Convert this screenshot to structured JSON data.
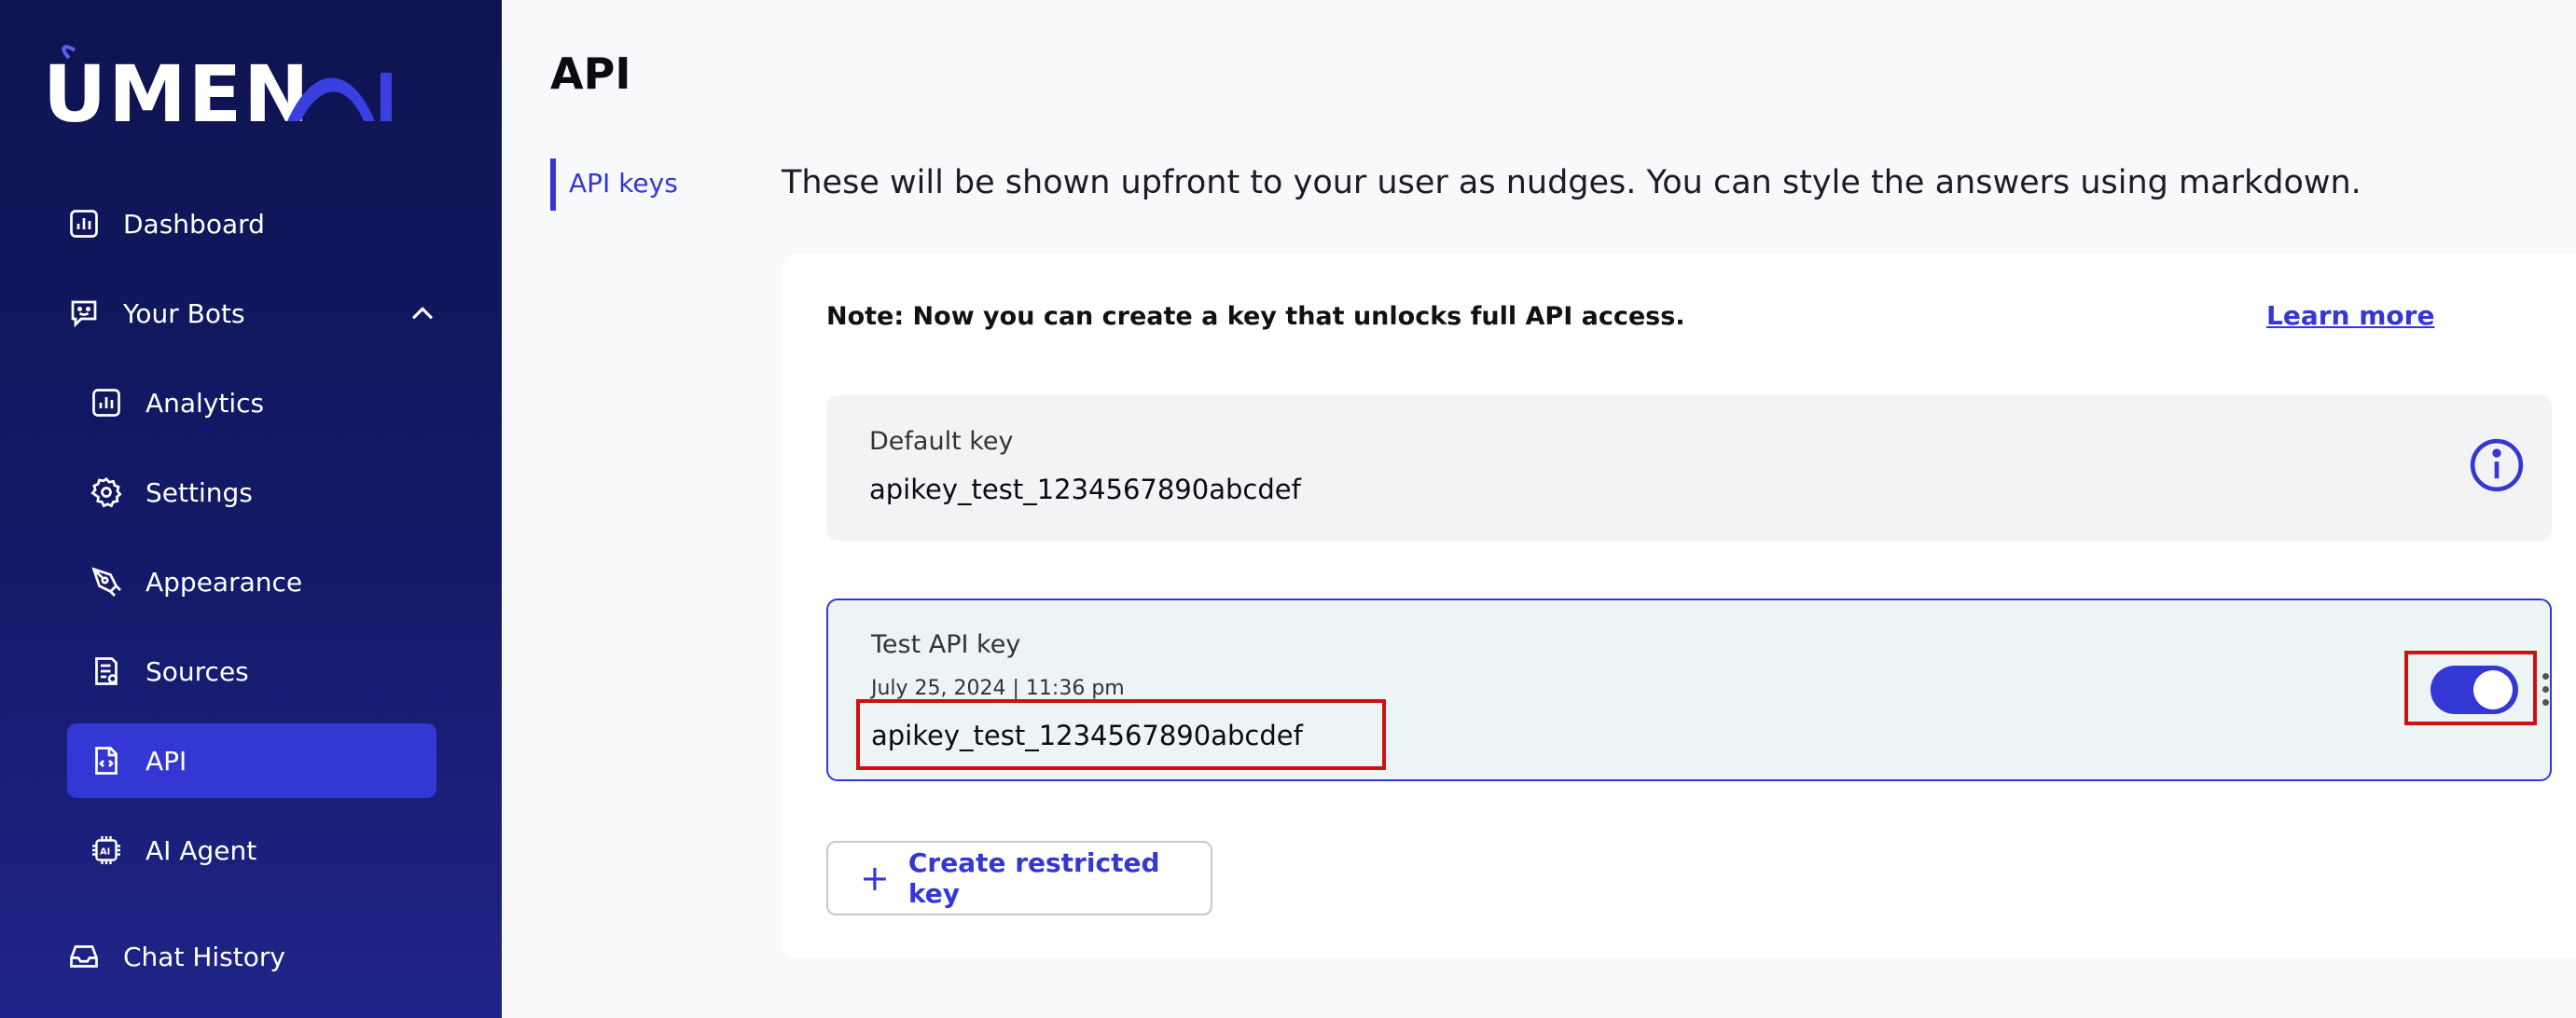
{
  "brand": {
    "name": "UMENAI",
    "accent": "#3338d4",
    "sidebar_bg": "#141a68"
  },
  "sidebar": {
    "items": [
      {
        "label": "Dashboard",
        "icon": "bar-chart-icon"
      },
      {
        "label": "Your Bots",
        "icon": "bot-face-icon",
        "expanded": true
      },
      {
        "label": "Analytics",
        "icon": "bar-chart-icon"
      },
      {
        "label": "Settings",
        "icon": "gear-icon"
      },
      {
        "label": "Appearance",
        "icon": "pen-nib-icon"
      },
      {
        "label": "Sources",
        "icon": "document-icon"
      },
      {
        "label": "API",
        "icon": "code-file-icon",
        "active": true
      },
      {
        "label": "AI Agent",
        "icon": "ai-chip-icon"
      },
      {
        "label": "Chat History",
        "icon": "inbox-icon"
      }
    ]
  },
  "page": {
    "title": "API",
    "tabs": [
      {
        "label": "API keys",
        "active": true
      }
    ],
    "intro": "These will be shown upfront to your user as nudges. You can style the answers using markdown."
  },
  "card": {
    "note": "Note: Now you can create a key that unlocks full API access.",
    "learn_more": "Learn more",
    "default_key": {
      "title": "Default key",
      "value": "apikey_test_1234567890abcdef"
    },
    "test_key": {
      "title": "Test API key",
      "date": "July 25, 2024 | 11:36 pm",
      "value": "apikey_test_1234567890abcdef",
      "enabled": true
    },
    "create_button": "Create restricted key"
  }
}
